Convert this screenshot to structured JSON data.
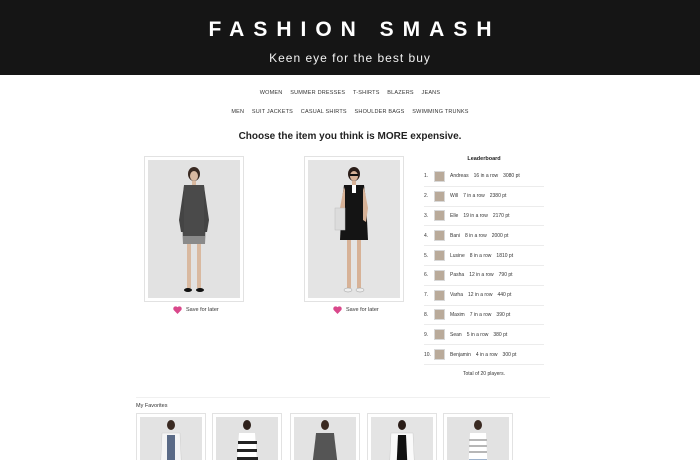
{
  "header": {
    "title": "FASHION SMASH",
    "tagline": "Keen eye for the best buy"
  },
  "nav": {
    "row1": [
      "WOMEN",
      "SUMMER DRESSES",
      "T-SHIRTS",
      "BLAZERS",
      "JEANS"
    ],
    "row2": [
      "MEN",
      "SUIT JACKETS",
      "CASUAL SHIRTS",
      "SHOULDER BAGS",
      "SWIMMING TRUNKS"
    ]
  },
  "prompt": "Choose the item you think is MORE expensive.",
  "products": {
    "save_label": "Save for later",
    "heart_color": "#d9488b"
  },
  "leaderboard": {
    "title": "Leaderboard",
    "rows": [
      {
        "rank": "1.",
        "name": "Andreas",
        "streak": "16 in a row",
        "points": "3080 pt"
      },
      {
        "rank": "2.",
        "name": "Will",
        "streak": "7 in a row",
        "points": "2380 pt"
      },
      {
        "rank": "3.",
        "name": "Elle",
        "streak": "19 in a row",
        "points": "2170 pt"
      },
      {
        "rank": "4.",
        "name": "Bani",
        "streak": "8 in a row",
        "points": "2000 pt"
      },
      {
        "rank": "5.",
        "name": "Lusine",
        "streak": "8 in a row",
        "points": "1810 pt"
      },
      {
        "rank": "6.",
        "name": "Pasha",
        "streak": "12 in a row",
        "points": "790 pt"
      },
      {
        "rank": "7.",
        "name": "Varha",
        "streak": "12 in a row",
        "points": "440 pt"
      },
      {
        "rank": "8.",
        "name": "Maxim",
        "streak": "7 in a row",
        "points": "390 pt"
      },
      {
        "rank": "9.",
        "name": "Sean",
        "streak": "5 in a row",
        "points": "380 pt"
      },
      {
        "rank": "10.",
        "name": "Benjamin",
        "streak": "4 in a row",
        "points": "300 pt"
      }
    ],
    "total": "Total of 20 players."
  },
  "favorites": {
    "title": "My Favorites"
  }
}
